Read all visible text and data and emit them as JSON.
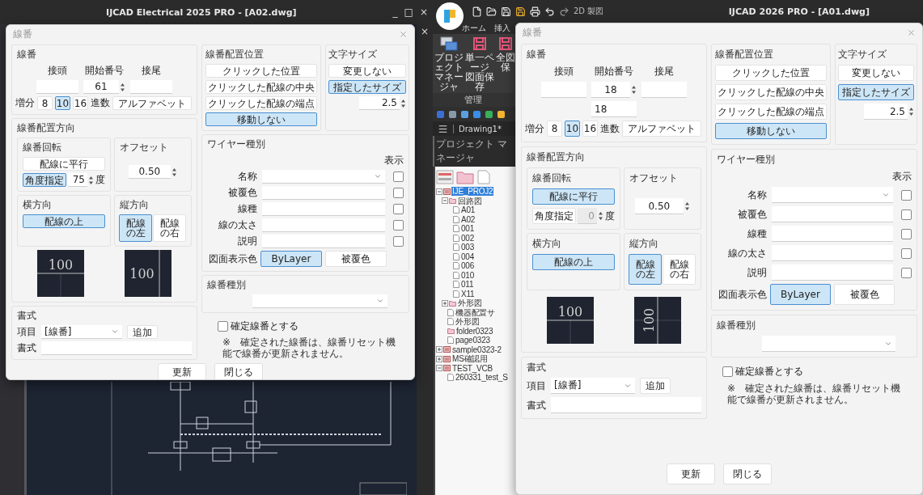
{
  "left_window": {
    "title": "IJCAD Electrical 2025 PRO - [A02.dwg]",
    "controls": [
      "_",
      "□",
      "×"
    ],
    "doc_close": "×",
    "dialog": {
      "title": "線番",
      "number": {
        "legend": "線番",
        "labels": [
          "接頭",
          "開始番号",
          "接尾"
        ],
        "start": "61",
        "increment_label": "増分",
        "bases": [
          {
            "label": "8",
            "selected": false
          },
          {
            "label": "10",
            "selected": true
          },
          {
            "label": "16",
            "selected": false
          }
        ],
        "base_label": "進数",
        "alphabet": "アルファベット"
      },
      "placement": {
        "legend": "線番配置位置",
        "options": [
          {
            "label": "クリックした位置",
            "selected": false
          },
          {
            "label": "クリックした配線の中央",
            "selected": false
          },
          {
            "label": "クリックした配線の端点",
            "selected": false
          },
          {
            "label": "移動しない",
            "selected": true
          }
        ]
      },
      "text_size": {
        "legend": "文字サイズ",
        "options": [
          {
            "label": "変更しない",
            "selected": false
          },
          {
            "label": "指定したサイズ",
            "selected": true
          }
        ],
        "value": "2.5"
      },
      "direction": {
        "legend": "線番配置方向",
        "rotation": {
          "legend": "線番回転",
          "options": [
            {
              "label": "配線に平行",
              "selected": false
            },
            {
              "label": "角度指定",
              "selected": true
            }
          ],
          "angle": "75",
          "angle_disabled": false,
          "unit": "度"
        },
        "offset": {
          "legend": "オフセット",
          "value": "0.50"
        },
        "horizontal": {
          "legend": "横方向",
          "options": [
            {
              "label": "配線の上",
              "selected": true
            }
          ]
        },
        "vertical": {
          "legend": "縦方向",
          "options": [
            {
              "label": "配線の左",
              "selected": true
            },
            {
              "label": "配線の右",
              "selected": false
            }
          ]
        },
        "previews": [
          {
            "text": "100",
            "kind": "horizontal"
          },
          {
            "text": "100",
            "kind": "beside"
          }
        ]
      },
      "wire_type": {
        "legend": "ワイヤー種別",
        "show_label": "表示",
        "rows": [
          {
            "label": "名称",
            "kind": "select",
            "checked": false
          },
          {
            "label": "被覆色",
            "kind": "text",
            "checked": false
          },
          {
            "label": "線種",
            "kind": "text",
            "checked": false
          },
          {
            "label": "線の太さ",
            "kind": "text",
            "checked": false
          },
          {
            "label": "説明",
            "kind": "text",
            "checked": false
          }
        ],
        "color_label": "図面表示色",
        "color_options": [
          {
            "label": "ByLayer",
            "selected": true
          },
          {
            "label": "被覆色",
            "selected": false
          }
        ]
      },
      "number_type": {
        "legend": "線番種別"
      },
      "fixed": {
        "label": "確定線番とする",
        "checked": false,
        "note": "※　確定された線番は、線番リセット機能で線番が更新されません。"
      },
      "format": {
        "legend": "書式",
        "item_label": "項目",
        "item_value": "[線番]",
        "add": "追加",
        "format_label": "書式"
      },
      "buttons": [
        "更新",
        "閉じる"
      ]
    }
  },
  "right_window": {
    "quick_access_label": "2D 製図",
    "title": "IJCAD 2026 PRO - [A01.dwg]",
    "ribbon_tabs": [
      {
        "label": "ホーム",
        "selected": false
      },
      {
        "label": "挿入",
        "selected": false
      }
    ],
    "ribbon_buttons": [
      {
        "lines": [
          "プロジェクト",
          "マネージャ"
        ],
        "kind": "windows"
      },
      {
        "lines": [
          "単一ページ",
          "図面保存"
        ],
        "kind": "disk"
      },
      {
        "lines": [
          "全図",
          "保"
        ],
        "kind": "disk"
      }
    ],
    "ribbon_group": "管理",
    "doc_tab": "Drawing1*",
    "panel_title": "プロジェクト マネージャ",
    "tree": [
      {
        "label": "IJE_PROJ2",
        "kind": "project",
        "selected": true,
        "expanded": true,
        "children": [
          {
            "label": "回路図",
            "kind": "folder",
            "selected": false,
            "expanded": true,
            "children": [
              {
                "label": "A01",
                "kind": "page",
                "selected": false
              },
              {
                "label": "A02",
                "kind": "page",
                "selected": false
              },
              {
                "label": "001",
                "kind": "page",
                "selected": false
              },
              {
                "label": "002",
                "kind": "page",
                "selected": false
              },
              {
                "label": "003",
                "kind": "page",
                "selected": false
              },
              {
                "label": "004",
                "kind": "page",
                "selected": false
              },
              {
                "label": "006",
                "kind": "page",
                "selected": false
              },
              {
                "label": "010",
                "kind": "page",
                "selected": false
              },
              {
                "label": "011",
                "kind": "page",
                "selected": false
              },
              {
                "label": "X11",
                "kind": "page",
                "selected": false
              }
            ]
          },
          {
            "label": "外形図",
            "kind": "folder",
            "selected": false,
            "expanded": false
          },
          {
            "label": "機器配置サ",
            "kind": "page",
            "selected": false
          },
          {
            "label": "外形図",
            "kind": "page",
            "selected": false
          },
          {
            "label": "folder0323",
            "kind": "folder",
            "selected": false
          },
          {
            "label": "page0323",
            "kind": "page",
            "selected": false
          }
        ]
      },
      {
        "label": "sample0323-2",
        "kind": "project",
        "selected": false,
        "expanded": false
      },
      {
        "label": "MS確認用",
        "kind": "project",
        "selected": false,
        "expanded": false
      },
      {
        "label": "TEST_VCB",
        "kind": "project",
        "selected": false,
        "expanded": true,
        "children": [
          {
            "label": "260331_test_S",
            "kind": "page",
            "selected": false
          }
        ]
      }
    ],
    "dialog": {
      "title": "線番",
      "number": {
        "legend": "線番",
        "labels": [
          "接頭",
          "開始番号",
          "接尾"
        ],
        "start": "18",
        "preview": "18",
        "increment_label": "増分",
        "bases": [
          {
            "label": "8",
            "selected": false
          },
          {
            "label": "10",
            "selected": true
          },
          {
            "label": "16",
            "selected": false
          }
        ],
        "base_label": "進数",
        "alphabet": "アルファベット"
      },
      "placement": {
        "legend": "線番配置位置",
        "options": [
          {
            "label": "クリックした位置",
            "selected": false
          },
          {
            "label": "クリックした配線の中央",
            "selected": false
          },
          {
            "label": "クリックした配線の端点",
            "selected": false
          },
          {
            "label": "移動しない",
            "selected": true
          }
        ]
      },
      "text_size": {
        "legend": "文字サイズ",
        "options": [
          {
            "label": "変更しない",
            "selected": false
          },
          {
            "label": "指定したサイズ",
            "selected": true
          }
        ],
        "value": "2.5"
      },
      "direction": {
        "legend": "線番配置方向",
        "rotation": {
          "legend": "線番回転",
          "options": [
            {
              "label": "配線に平行",
              "selected": true
            },
            {
              "label": "角度指定",
              "selected": false
            }
          ],
          "angle": "0",
          "angle_disabled": true,
          "unit": "度"
        },
        "offset": {
          "legend": "オフセット",
          "value": "0.50"
        },
        "horizontal": {
          "legend": "横方向",
          "options": [
            {
              "label": "配線の上",
              "selected": true
            }
          ]
        },
        "vertical": {
          "legend": "縦方向",
          "options": [
            {
              "label": "配線の左",
              "selected": true
            },
            {
              "label": "配線の右",
              "selected": false
            }
          ]
        },
        "previews": [
          {
            "text": "100",
            "kind": "horizontal"
          },
          {
            "text": "100",
            "kind": "rotated"
          }
        ]
      },
      "wire_type": {
        "legend": "ワイヤー種別",
        "show_label": "表示",
        "rows": [
          {
            "label": "名称",
            "kind": "select",
            "checked": false
          },
          {
            "label": "被覆色",
            "kind": "text",
            "checked": false
          },
          {
            "label": "線種",
            "kind": "text",
            "checked": false
          },
          {
            "label": "線の太さ",
            "kind": "text",
            "checked": false
          },
          {
            "label": "説明",
            "kind": "text",
            "checked": false
          }
        ],
        "color_label": "図面表示色",
        "color_options": [
          {
            "label": "ByLayer",
            "selected": true
          },
          {
            "label": "被覆色",
            "selected": false
          }
        ]
      },
      "number_type": {
        "legend": "線番種別"
      },
      "fixed": {
        "label": "確定線番とする",
        "checked": false,
        "note": "※　確定された線番は、線番リセット機能で線番が更新されません。"
      },
      "format": {
        "legend": "書式",
        "item_label": "項目",
        "item_value": "[線番]",
        "add": "追加",
        "format_label": "書式"
      },
      "buttons": [
        "更新",
        "閉じる"
      ]
    }
  }
}
